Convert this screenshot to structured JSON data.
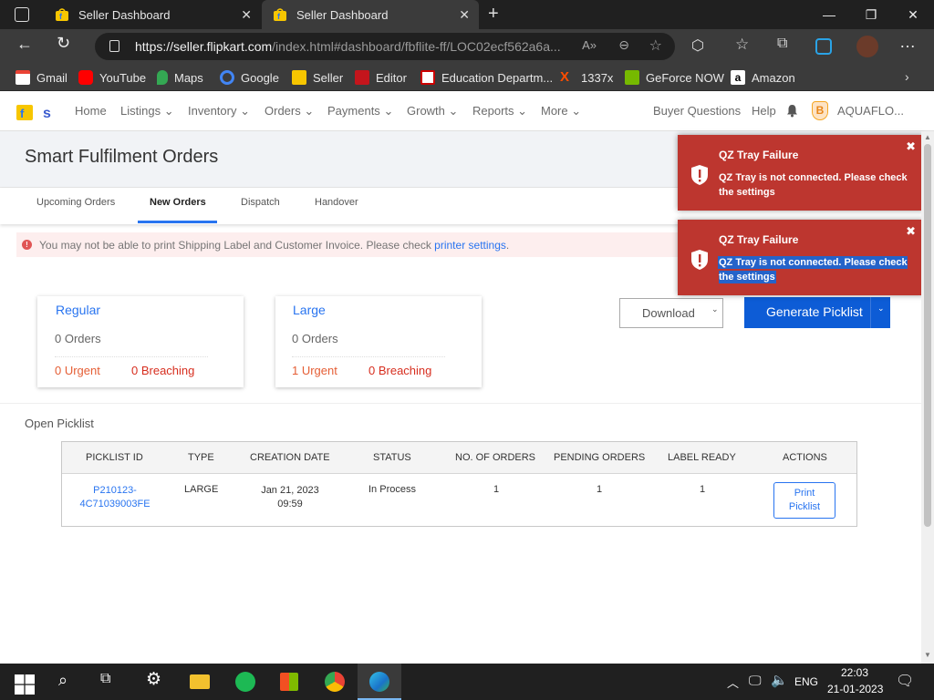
{
  "browser": {
    "tabs": [
      {
        "title": "Seller Dashboard",
        "active": false
      },
      {
        "title": "Seller Dashboard",
        "active": true
      }
    ],
    "url_host": "https://seller.flipkart.com",
    "url_path": "/index.html#dashboard/fbflite-ff/LOC02ecf562a6a...",
    "bookmarks": [
      "Gmail",
      "YouTube",
      "Maps",
      "Google",
      "Seller",
      "Editor",
      "Education Departm...",
      "1337x",
      "GeForce NOW",
      "Amazon"
    ]
  },
  "app_nav": {
    "home": "Home",
    "listings": "Listings",
    "inventory": "Inventory",
    "orders": "Orders",
    "payments": "Payments",
    "growth": "Growth",
    "reports": "Reports",
    "more": "More",
    "buyer_questions": "Buyer Questions",
    "help": "Help",
    "account": "AQUAFLO...",
    "account_initial": "B"
  },
  "page": {
    "title": "Smart Fulfilment Orders",
    "subtabs": [
      "Upcoming Orders",
      "New Orders",
      "Dispatch",
      "Handover"
    ],
    "active_subtab": "New Orders",
    "alert_text": "You may not be able to print Shipping Label and Customer Invoice. Please check",
    "alert_link": "printer settings",
    "alert_end": ".",
    "cards": [
      {
        "title": "Regular",
        "orders": "0 Orders",
        "urgent": "0 Urgent",
        "breaching": "0 Breaching"
      },
      {
        "title": "Large",
        "orders": "0 Orders",
        "urgent": "1 Urgent",
        "breaching": "0 Breaching"
      }
    ],
    "download_label": "Download",
    "generate_label": "Generate Picklist",
    "open_picklist_label": "Open Picklist",
    "table": {
      "headers": [
        "PICKLIST ID",
        "TYPE",
        "CREATION DATE",
        "STATUS",
        "NO. OF ORDERS",
        "PENDING ORDERS",
        "LABEL READY",
        "ACTIONS"
      ],
      "row": {
        "id_line1": "P210123-",
        "id_line2": "4C71039003FE",
        "type": "LARGE",
        "date_line1": "Jan 21, 2023",
        "date_line2": "09:59",
        "status": "In Process",
        "orders": "1",
        "pending": "1",
        "label_ready": "1",
        "action_line1": "Print",
        "action_line2": "Picklist"
      }
    }
  },
  "toasts": [
    {
      "title": "QZ Tray Failure",
      "message": "QZ Tray is not connected. Please check the settings",
      "close": "✖"
    },
    {
      "title": "QZ Tray Failure",
      "message": "QZ Tray is not connected. Please check the settings",
      "close": "✖"
    }
  ],
  "taskbar": {
    "language": "ENG",
    "time": "22:03",
    "date": "21-01-2023"
  },
  "colors": {
    "brand_blue": "#2874f0",
    "toast_red": "#bd362f",
    "urgent_orange": "#e55e35",
    "breaching_red": "#d72e1f"
  }
}
